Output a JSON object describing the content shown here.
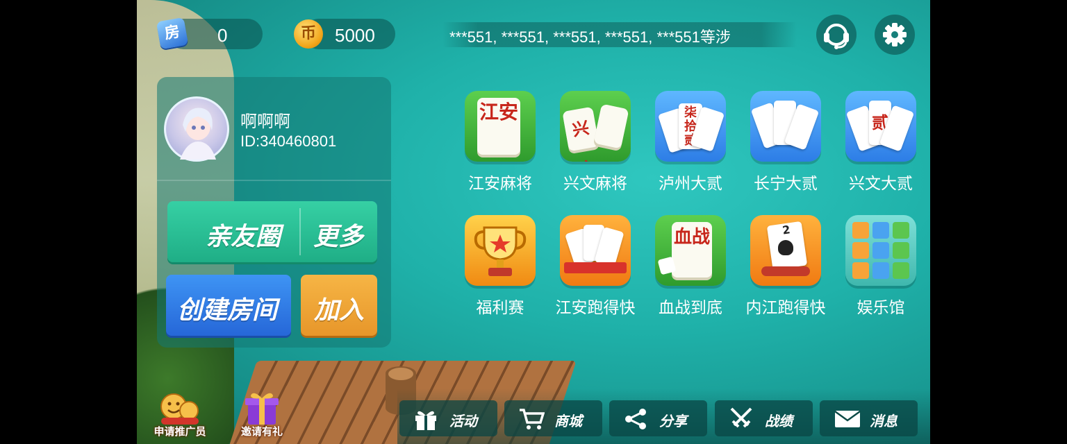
{
  "topbar": {
    "room_cards": {
      "icon": "room-card-icon",
      "icon_char": "房",
      "value": "0"
    },
    "coins": {
      "icon": "coin-icon",
      "icon_char": "币",
      "value": "5000"
    },
    "marquee": "***551, ***551, ***551, ***551, ***551等涉",
    "service_icon": "headset-icon",
    "settings_icon": "gear-icon"
  },
  "profile": {
    "name": "啊啊啊",
    "id": "ID:340460801"
  },
  "actions": {
    "friend_circle": "亲友圈",
    "more": "更多",
    "create_room": "创建房间",
    "join": "加入"
  },
  "games": [
    {
      "label": "江安麻将",
      "chars": "江安"
    },
    {
      "label": "兴文麻将",
      "chars": "兴文"
    },
    {
      "label": "泸州大贰",
      "chars": "柒拾贰"
    },
    {
      "label": "长宁大贰",
      "chars": ""
    },
    {
      "label": "兴文大贰",
      "chars": "贰"
    },
    {
      "label": "福利赛",
      "chars": ""
    },
    {
      "label": "江安跑得快",
      "chars": ""
    },
    {
      "label": "血战到底",
      "chars": "血战"
    },
    {
      "label": "内江跑得快",
      "chars": "2"
    },
    {
      "label": "娱乐馆",
      "chars": ""
    }
  ],
  "promos": [
    {
      "label": "申请推广员",
      "icon": "smiley-icon"
    },
    {
      "label": "邀请有礼",
      "icon": "gift-box-icon"
    }
  ],
  "bottom_nav": [
    {
      "label": "活动",
      "icon": "gift-icon"
    },
    {
      "label": "商城",
      "icon": "cart-icon"
    },
    {
      "label": "分享",
      "icon": "share-icon"
    },
    {
      "label": "战绩",
      "icon": "crossed-swords-icon"
    },
    {
      "label": "消息",
      "icon": "mail-icon"
    }
  ],
  "colors": {
    "background": "#1fb1a9",
    "friend_button": "#27bd92",
    "create_button": "#2f7de6",
    "join_button": "#eea436"
  }
}
